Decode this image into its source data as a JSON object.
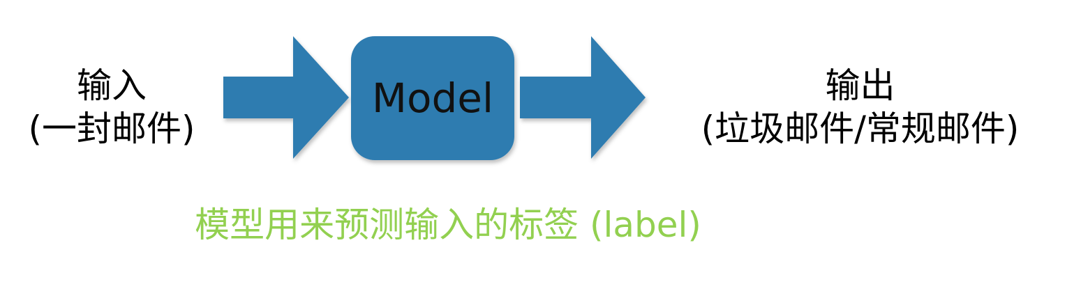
{
  "diagram": {
    "input": {
      "line1": "输入",
      "line2": "(一封邮件)"
    },
    "model": {
      "label": "Model"
    },
    "output": {
      "line1": "输出",
      "line2": "(垃圾邮件/常规邮件)"
    },
    "caption": "模型用来预测输入的标签 (label)",
    "colors": {
      "arrow": "#2e7cb0",
      "model_box": "#2e7cb0",
      "caption": "#92d050",
      "text": "#000000"
    }
  }
}
